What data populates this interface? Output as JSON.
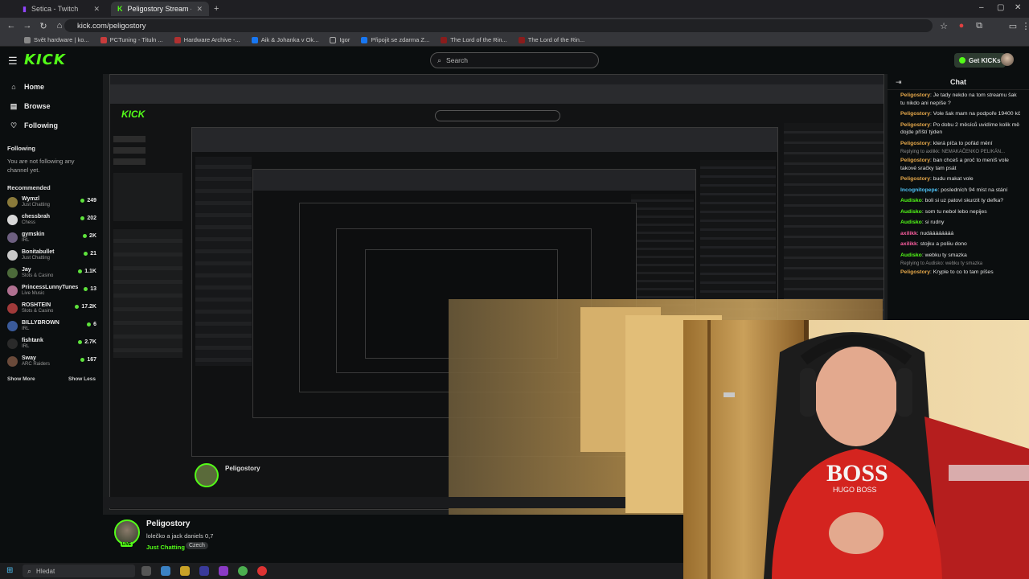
{
  "browser": {
    "tabs": [
      {
        "label": "Setica - Twitch",
        "active": false
      },
      {
        "label": "Peligostory Stream - Watch Li...",
        "active": true
      }
    ],
    "url": "kick.com/peligostory",
    "bookmarks": [
      "Svět hardware | ko...",
      "PCTuning - Tituln ...",
      "Hardware Archive -...",
      "Aik & Johanka v Ok...",
      "Igor",
      "Připojit se zdarma Z...",
      "The Lord of the Rin...",
      "The Lord of the Rin..."
    ]
  },
  "header": {
    "logo": "KICK",
    "search_placeholder": "Search",
    "get_kicks": "Get KICKs"
  },
  "sidebar": {
    "nav": [
      {
        "label": "Home",
        "icon": "home-icon"
      },
      {
        "label": "Browse",
        "icon": "browse-icon"
      },
      {
        "label": "Following",
        "icon": "heart-icon"
      }
    ],
    "following_title": "Following",
    "not_following": "You are not following any channel yet.",
    "recommended_title": "Recommended",
    "recommended": [
      {
        "name": "Wymzl",
        "category": "Just Chatting",
        "viewers": "249"
      },
      {
        "name": "chessbrah",
        "category": "Chess",
        "viewers": "202"
      },
      {
        "name": "gymskin",
        "category": "IRL",
        "viewers": "2K"
      },
      {
        "name": "Bonitabullet",
        "category": "Just Chatting",
        "viewers": "21"
      },
      {
        "name": "Jay",
        "category": "Slots & Casino",
        "viewers": "1.1K"
      },
      {
        "name": "PrincessLunnyTunes",
        "category": "Live Music",
        "viewers": "13"
      },
      {
        "name": "ROSHTEIN",
        "category": "Slots & Casino",
        "viewers": "17.2K"
      },
      {
        "name": "BILLYBROWN",
        "category": "IRL",
        "viewers": "6"
      },
      {
        "name": "fishtank",
        "category": "IRL",
        "viewers": "2.7K"
      },
      {
        "name": "Sway",
        "category": "ARC Raiders",
        "viewers": "167"
      }
    ],
    "show_more": "Show More",
    "show_less": "Show Less"
  },
  "channel": {
    "name": "Peligostory",
    "title": "lolečko a jack daniels 0,7",
    "category": "Just Chatting",
    "tag": "Czech",
    "live_badge": "LIVE"
  },
  "chat": {
    "title": "Chat",
    "messages": [
      {
        "user": "Peligostory",
        "color": "#e6a84a",
        "text": "Je tady nekdo na tom streamu šak tu nikdo ani nepíše ?",
        "reply": ""
      },
      {
        "user": "Peligostory",
        "color": "#e6a84a",
        "text": "Vole šak mam na podpoře 19400 kč",
        "reply": ""
      },
      {
        "user": "Peligostory",
        "color": "#e6a84a",
        "text": "Po dobu 2 měsíců uvidíme kolik mě dojde příští týden",
        "reply": ""
      },
      {
        "user": "Peligostory",
        "color": "#e6a84a",
        "text": "která píča to pořád mění",
        "reply": ""
      },
      {
        "user": "Peligostory",
        "color": "#e6a84a",
        "text": "ban chceš a proč to meníš vole takové sračky tam psát",
        "reply": "Replying to axilikk: NEMAKAČENKO PELIKÁN..."
      },
      {
        "user": "Peligostory",
        "color": "#e6a84a",
        "text": "budu makat vole",
        "reply": ""
      },
      {
        "user": "Incognitopepe",
        "color": "#4fc3f7",
        "text": "posledních 94 míst na stání",
        "reply": ""
      },
      {
        "user": "Audisko",
        "color": "#53fc18",
        "text": "boli si uz patovi skurzit ty defka?",
        "reply": ""
      },
      {
        "user": "Audisko",
        "color": "#53fc18",
        "text": "som tu nebol lebo nepijes",
        "reply": ""
      },
      {
        "user": "Audisko",
        "color": "#53fc18",
        "text": "si rudny",
        "reply": ""
      },
      {
        "user": "axilikk",
        "color": "#ff5fa2",
        "text": "nudáááááááá",
        "reply": ""
      },
      {
        "user": "axilikk",
        "color": "#ff5fa2",
        "text": "stojku a poliiu dono",
        "reply": ""
      },
      {
        "user": "Audisko",
        "color": "#53fc18",
        "text": "webku ty smazka",
        "reply": ""
      },
      {
        "user": "Peligostory",
        "color": "#e6a84a",
        "text": "Kryple to co to tam píšes",
        "reply": "Replying to Audisko: webku ty smazka"
      }
    ]
  },
  "taskbar": {
    "search_placeholder": "Hledat"
  },
  "colors": {
    "accent": "#53fc18",
    "bg": "#0b0e0f"
  }
}
